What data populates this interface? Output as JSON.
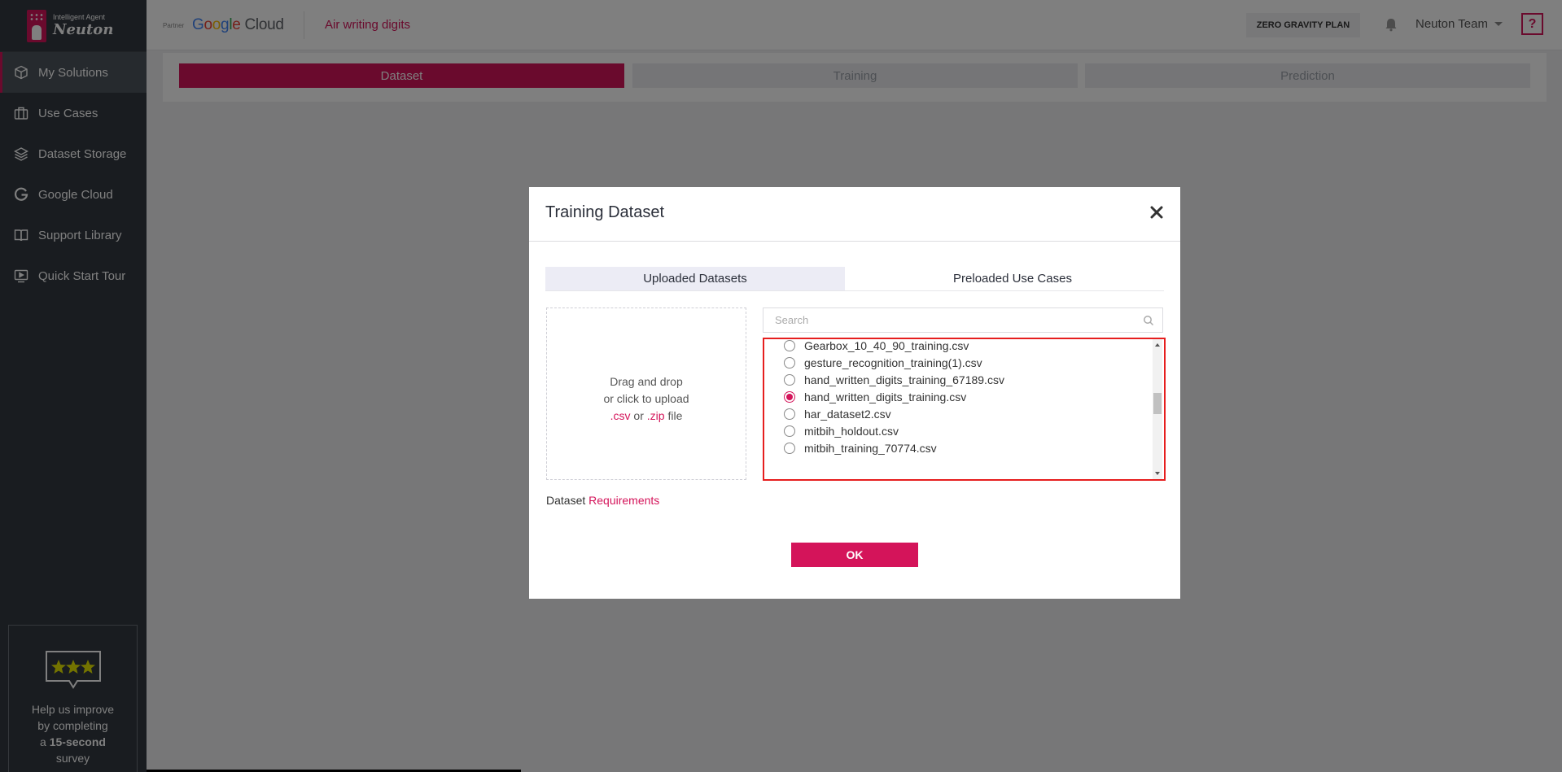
{
  "brand": {
    "subtitle": "Intelligent Agent",
    "name": "Neuton",
    "color": "#d4145a"
  },
  "sidebar": {
    "items": [
      {
        "label": "My Solutions",
        "icon": "cube-icon",
        "active": true
      },
      {
        "label": "Use Cases",
        "icon": "briefcase-icon",
        "active": false
      },
      {
        "label": "Dataset Storage",
        "icon": "layers-icon",
        "active": false
      },
      {
        "label": "Google Cloud",
        "icon": "google-g-icon",
        "active": false
      },
      {
        "label": "Support Library",
        "icon": "book-icon",
        "active": false
      },
      {
        "label": "Quick Start Tour",
        "icon": "play-screen-icon",
        "active": false
      }
    ],
    "survey": {
      "line1": "Help us improve",
      "line2": "by completing",
      "line3a": "a",
      "line3b": "15-second",
      "line4": "survey",
      "icon": "rating-stars-icon"
    }
  },
  "topbar": {
    "partner_label": "Partner",
    "partner_name": "Google Cloud",
    "solution_name": "Air writing digits",
    "plan": "ZERO GRAVITY PLAN",
    "team": "Neuton Team",
    "help": "?"
  },
  "steps": [
    {
      "label": "Dataset",
      "active": true
    },
    {
      "label": "Training",
      "active": false
    },
    {
      "label": "Prediction",
      "active": false
    }
  ],
  "modal": {
    "title": "Training Dataset",
    "tabs": [
      {
        "label": "Uploaded Datasets",
        "active": true
      },
      {
        "label": "Preloaded Use Cases",
        "active": false
      }
    ],
    "dropzone": {
      "line1": "Drag and drop",
      "line2": "or click to upload",
      "ext_csv": ".csv",
      "or": "or",
      "ext_zip": ".zip",
      "file": "file"
    },
    "search_placeholder": "Search",
    "files": [
      {
        "name": "Gearbox_10_40_90_training.csv",
        "selected": false
      },
      {
        "name": "gesture_recognition_training(1).csv",
        "selected": false
      },
      {
        "name": "hand_written_digits_training_67189.csv",
        "selected": false
      },
      {
        "name": "hand_written_digits_training.csv",
        "selected": true
      },
      {
        "name": "har_dataset2.csv",
        "selected": false
      },
      {
        "name": "mitbih_holdout.csv",
        "selected": false
      },
      {
        "name": "mitbih_training_70774.csv",
        "selected": false
      }
    ],
    "requirements_prefix": "Dataset",
    "requirements_link": "Requirements",
    "ok_label": "OK"
  }
}
